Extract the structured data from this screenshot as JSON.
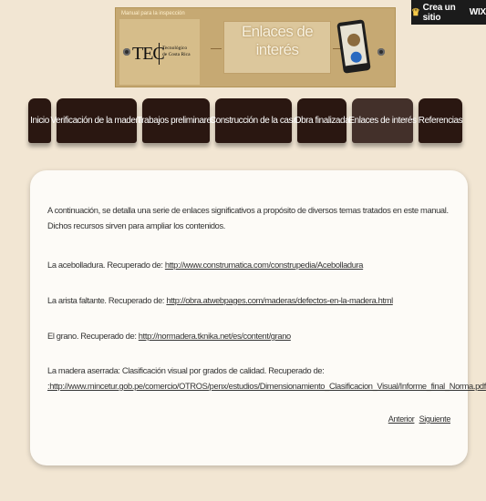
{
  "wix_badge": {
    "icon": "crown-icon",
    "label": "Crea un sitio",
    "brand": "WIX"
  },
  "header": {
    "manual_label": "Manual para la inspección",
    "logo_main": "TEC",
    "logo_sub_line1": "Tecnológico",
    "logo_sub_line2": "de Costa Rica",
    "title": "Enlaces de interés"
  },
  "nav": {
    "items": [
      {
        "label": "Inicio",
        "active": false
      },
      {
        "label": "Verificación de la madera",
        "active": false
      },
      {
        "label": "Trabajos preliminares",
        "active": false
      },
      {
        "label": "Construcción de la casa",
        "active": false
      },
      {
        "label": "Obra finalizada",
        "active": false
      },
      {
        "label": "Enlaces de interés",
        "active": true
      },
      {
        "label": "Referencias",
        "active": false
      }
    ]
  },
  "content": {
    "intro": "A continuación, se detalla una serie de enlaces significativos a propósito de diversos temas tratados en este manual. Dichos recursos sirven para ampliar los contenidos.",
    "refs": [
      {
        "text": "La acebolladura. Recuperado de: ",
        "link": "http://www.construmatica.com/construpedia/Acebolladura"
      },
      {
        "text": "La arista faltante. Recuperado de: ",
        "link": "http://obra.atwebpages.com/maderas/defectos-en-la-madera.html"
      },
      {
        "text": "El grano. Recuperado de: ",
        "link": "http://normadera.tknika.net/es/content/grano"
      },
      {
        "text": "La madera aserrada: Clasificación visual por grados de calidad. Recuperado de:",
        "link": ":http://www.mincetur.gob.pe/comercio/OTROS/penx/estudios/Dimensionamiento_Clasificacion_Visual/Informe_final_Norma.pdf"
      }
    ],
    "pager": {
      "previous": "Anterior",
      "next": "Siguiente"
    }
  },
  "colors": {
    "page_bg": "#f2e6d3",
    "nav_bg": "#2a1711",
    "nav_active_bg": "#43302a",
    "card_bg": "#fdfbf7"
  }
}
